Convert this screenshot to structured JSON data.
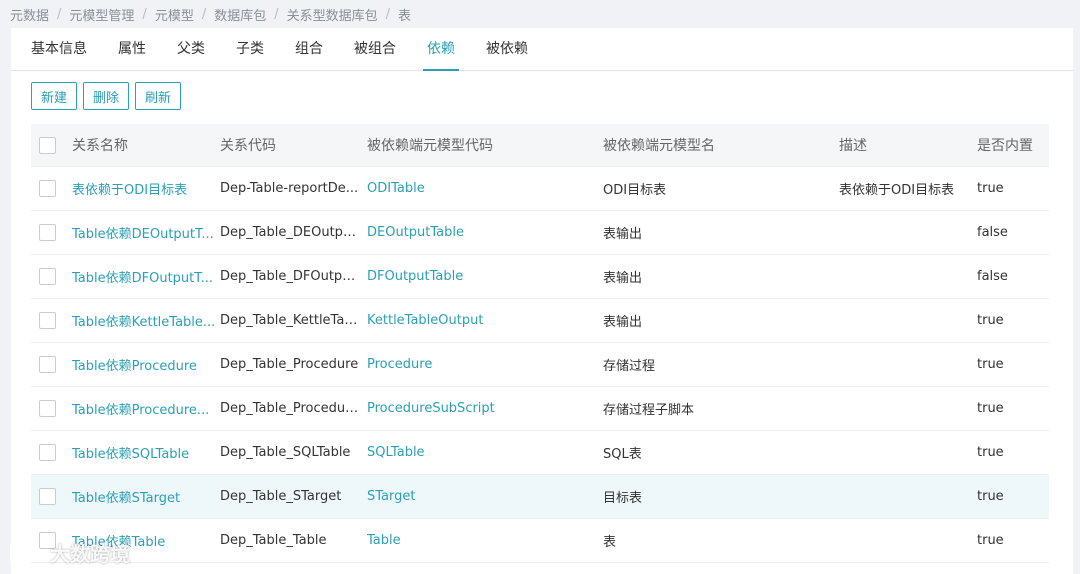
{
  "breadcrumb": [
    "元数据",
    "元模型管理",
    "元模型",
    "数据库包",
    "关系型数据库包",
    "表"
  ],
  "tabs": [
    {
      "label": "基本信息",
      "active": false
    },
    {
      "label": "属性",
      "active": false
    },
    {
      "label": "父类",
      "active": false
    },
    {
      "label": "子类",
      "active": false
    },
    {
      "label": "组合",
      "active": false
    },
    {
      "label": "被组合",
      "active": false
    },
    {
      "label": "依赖",
      "active": true
    },
    {
      "label": "被依赖",
      "active": false
    }
  ],
  "toolbar": {
    "new_label": "新建",
    "delete_label": "删除",
    "refresh_label": "刷新"
  },
  "table": {
    "headers": [
      "关系名称",
      "关系代码",
      "被依赖端元模型代码",
      "被依赖端元模型名",
      "描述",
      "是否内置"
    ],
    "rows": [
      {
        "name": "表依赖于ODI目标表",
        "code": "Dep-Table-reportDe...",
        "target_code": "ODITable",
        "target_name": "ODI目标表",
        "desc": "表依赖于ODI目标表",
        "builtin": "true"
      },
      {
        "name": "Table依赖DEOutputT...",
        "code": "Dep_Table_DEOutpu...",
        "target_code": "DEOutputTable",
        "target_name": "表输出",
        "desc": "",
        "builtin": "false"
      },
      {
        "name": "Table依赖DFOutputT...",
        "code": "Dep_Table_DFOutpu...",
        "target_code": "DFOutputTable",
        "target_name": "表输出",
        "desc": "",
        "builtin": "false"
      },
      {
        "name": "Table依赖KettleTable...",
        "code": "Dep_Table_KettleTab...",
        "target_code": "KettleTableOutput",
        "target_name": "表输出",
        "desc": "",
        "builtin": "true"
      },
      {
        "name": "Table依赖Procedure",
        "code": "Dep_Table_Procedure",
        "target_code": "Procedure",
        "target_name": "存储过程",
        "desc": "",
        "builtin": "true"
      },
      {
        "name": "Table依赖Procedure...",
        "code": "Dep_Table_Procedur...",
        "target_code": "ProcedureSubScript",
        "target_name": "存储过程子脚本",
        "desc": "",
        "builtin": "true"
      },
      {
        "name": "Table依赖SQLTable",
        "code": "Dep_Table_SQLTable",
        "target_code": "SQLTable",
        "target_name": "SQL表",
        "desc": "",
        "builtin": "true"
      },
      {
        "name": "Table依赖STarget",
        "code": "Dep_Table_STarget",
        "target_code": "STarget",
        "target_name": "目标表",
        "desc": "",
        "builtin": "true",
        "highlight": true
      },
      {
        "name": "Table依赖Table",
        "code": "Dep_Table_Table",
        "target_code": "Table",
        "target_name": "表",
        "desc": "",
        "builtin": "true"
      }
    ]
  },
  "watermark": {
    "text": "大数跨境"
  },
  "colors": {
    "accent": "#2b9fb5",
    "background": "#f0f2f5",
    "header_bg": "#f5f6f8",
    "highlight_row": "#eef8fb"
  },
  "icons": {
    "row_select": "checkbox-icon",
    "watermark": "brand-logo-icon"
  }
}
